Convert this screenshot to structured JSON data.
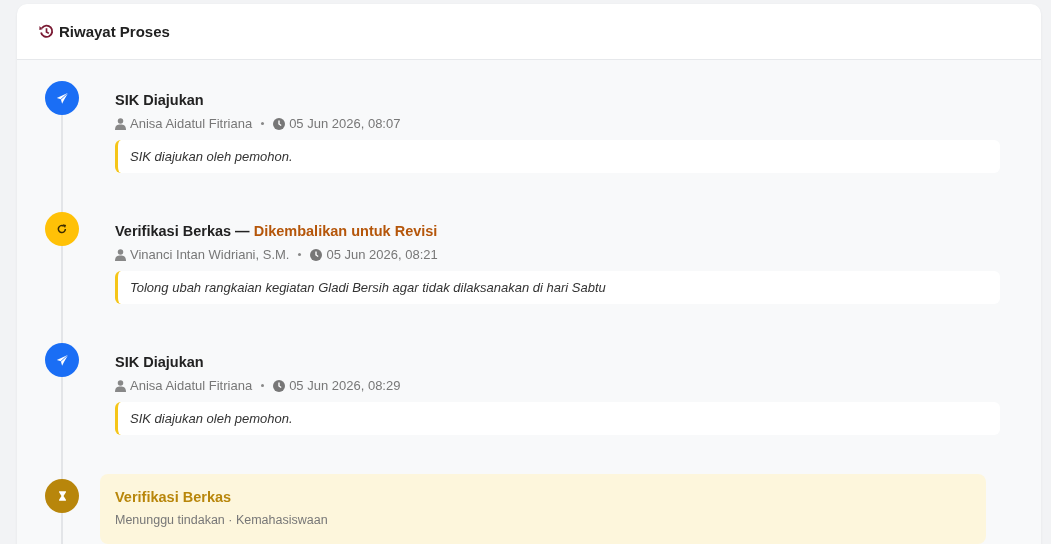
{
  "card": {
    "title": "Riwayat Proses"
  },
  "timeline": [
    {
      "kind": "submitted",
      "title": "SIK Diajukan",
      "user": "Anisa Aidatul Fitriana",
      "time": "05 Jun 2026, 08:07",
      "note": "SIK diajukan oleh pemohon."
    },
    {
      "kind": "returned",
      "title": "Verifikasi Berkas —",
      "status": "Dikembalikan untuk Revisi",
      "user": "Vinanci Intan Widriani, S.M.",
      "time": "05 Jun 2026, 08:21",
      "note": "Tolong ubah rangkaian kegiatan Gladi Bersih agar tidak dilaksanakan di hari Sabtu"
    },
    {
      "kind": "submitted",
      "title": "SIK Diajukan",
      "user": "Anisa Aidatul Fitriana",
      "time": "05 Jun 2026, 08:29",
      "note": "SIK diajukan oleh pemohon."
    },
    {
      "kind": "pending",
      "title": "Verifikasi Berkas",
      "subtitle": "Menunggu tindakan · Kemahasiswaan"
    }
  ]
}
